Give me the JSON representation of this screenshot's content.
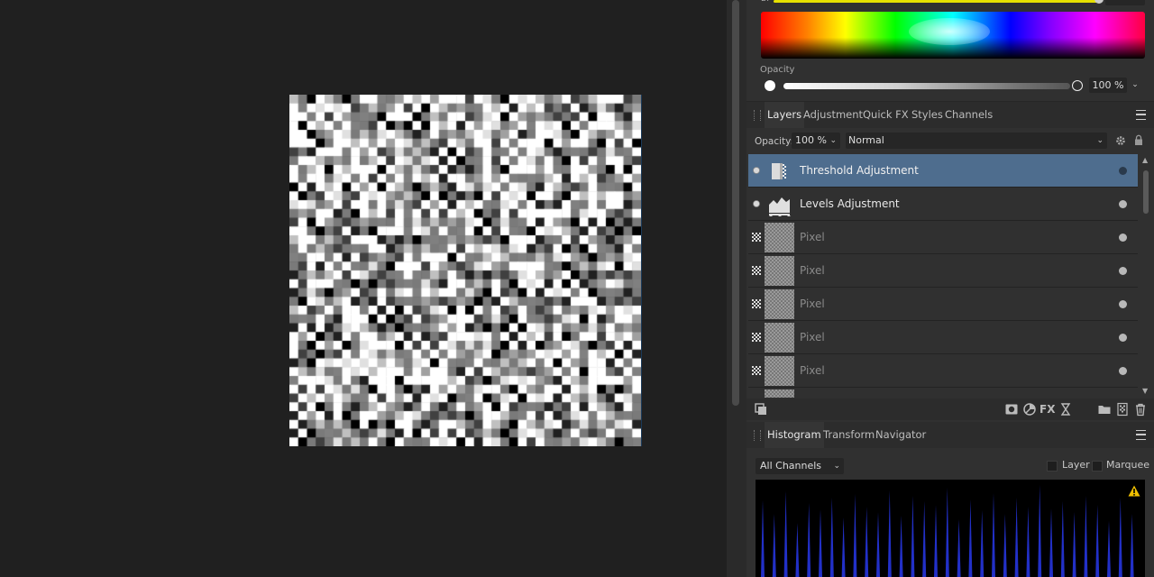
{
  "colors": {
    "selected_layer": "#4e6d8e",
    "histogram_spike": "#2230c8",
    "warning": "#f0c000",
    "top_slider": "#e6e000"
  },
  "color_panel": {
    "top_value": "255",
    "opacity_label": "Opacity",
    "opacity_value": "100 %",
    "opacity_chevron": "⌄"
  },
  "panel_tabs": [
    "Layers",
    "Adjustment",
    "Quick FX",
    "Styles",
    "Channels"
  ],
  "layer_options": {
    "opacity_label": "Opacity:",
    "opacity_value": "100 %",
    "blend_mode": "Normal"
  },
  "layers": [
    {
      "name": "Threshold Adjustment",
      "icon": "threshold-adjustment-icon",
      "selected": true
    },
    {
      "name": "Levels Adjustment",
      "icon": "levels-adjustment-icon",
      "selected": false
    },
    {
      "name": "Pixel",
      "icon": "pixel-layer-thumbnail",
      "selected": false
    },
    {
      "name": "Pixel",
      "icon": "pixel-layer-thumbnail",
      "selected": false
    },
    {
      "name": "Pixel",
      "icon": "pixel-layer-thumbnail",
      "selected": false
    },
    {
      "name": "Pixel",
      "icon": "pixel-layer-thumbnail",
      "selected": false
    },
    {
      "name": "Pixel",
      "icon": "pixel-layer-thumbnail",
      "selected": false
    }
  ],
  "layer_tools": [
    "copy-layers-icon",
    "mask-icon",
    "adjustment-icon",
    "fx-icon",
    "live-filter-icon",
    "folder-icon",
    "add-pixel-layer-icon",
    "trash-icon"
  ],
  "lower_tabs": [
    "Histogram",
    "Transform",
    "Navigator"
  ],
  "histogram": {
    "channel": "All Channels",
    "layer_label": "Layer",
    "marquee_label": "Marquee",
    "warning_icon": "warning-icon"
  }
}
